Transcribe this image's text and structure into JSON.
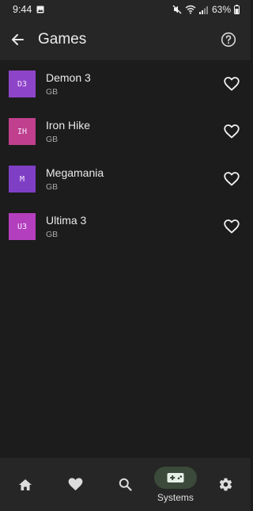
{
  "status_bar": {
    "time": "9:44",
    "battery": "63%"
  },
  "app_bar": {
    "title": "Games",
    "back_icon": "arrow-back-icon",
    "help_icon": "help-circle-icon"
  },
  "games": [
    {
      "thumb_text": "D3",
      "thumb_color": "#8e44c8",
      "name": "Demon 3",
      "system": "GB"
    },
    {
      "thumb_text": "IH",
      "thumb_color": "#c0408e",
      "name": "Iron Hike",
      "system": "GB"
    },
    {
      "thumb_text": "M",
      "thumb_color": "#7f3fc4",
      "name": "Megamania",
      "system": "GB"
    },
    {
      "thumb_text": "U3",
      "thumb_color": "#b43fbe",
      "name": "Ultima 3",
      "system": "GB"
    }
  ],
  "bottom_nav": {
    "items": [
      {
        "icon": "home-icon",
        "label": ""
      },
      {
        "icon": "heart-icon",
        "label": ""
      },
      {
        "icon": "search-icon",
        "label": ""
      },
      {
        "icon": "gamepad-icon",
        "label": "Systems",
        "active": true
      },
      {
        "icon": "gear-icon",
        "label": ""
      }
    ]
  },
  "colors": {
    "background": "#1c1c1c",
    "bar": "#262626",
    "active_pill": "#3b4a3b"
  }
}
